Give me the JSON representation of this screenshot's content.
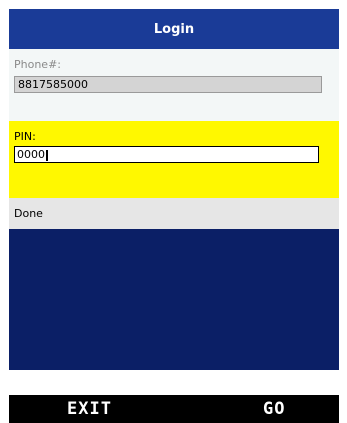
{
  "header": {
    "title": "Login"
  },
  "form": {
    "phone": {
      "label": "Phone#:",
      "value": "8817585000"
    },
    "pin": {
      "label": "PIN:",
      "value": "0000"
    },
    "done_label": "Done"
  },
  "softkeys": {
    "left_label": "EXIT",
    "right_label": "GO"
  },
  "colors": {
    "title_bar": "#1a3b97",
    "pin_highlight": "#fff800",
    "content_blue": "#0b1f66",
    "softkey_bar": "#000000"
  }
}
